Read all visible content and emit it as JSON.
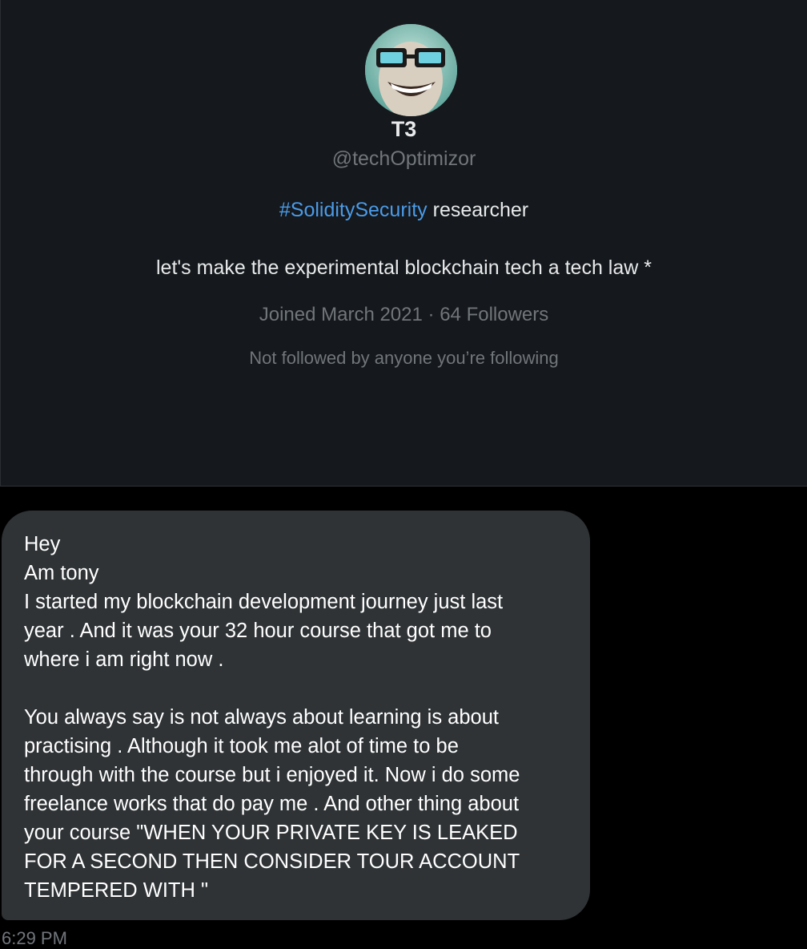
{
  "profile": {
    "display_name": "T3",
    "handle": "@techOptimizor",
    "bio_hashtag": "#SoliditySecurity",
    "bio_rest": " researcher",
    "bio_line2": "let's make  the experimental blockchain tech a tech law *",
    "joined": "Joined March 2021",
    "separator": "·",
    "followers": "64 Followers",
    "followed_note": "Not followed by anyone you’re following"
  },
  "message": {
    "text": "Hey\nAm tony\nI started my blockchain development journey just last\nyear . And it was your 32 hour course that got me to\nwhere i am right now .\n\nYou always say is not always about learning is about\npractising . Although it took me alot of time to be\nthrough with the course but i enjoyed it. Now i do some\nfreelance works that do pay me . And other thing about\nyour course \"WHEN YOUR PRIVATE KEY IS LEAKED\nFOR A SECOND THEN CONSIDER TOUR ACCOUNT\nTEMPERED WITH \"",
    "timestamp": "6:29 PM"
  },
  "colors": {
    "card_bg": "#15181c",
    "bubble_bg": "#2f3336",
    "hashtag": "#4a9be8",
    "muted": "#71767b"
  }
}
